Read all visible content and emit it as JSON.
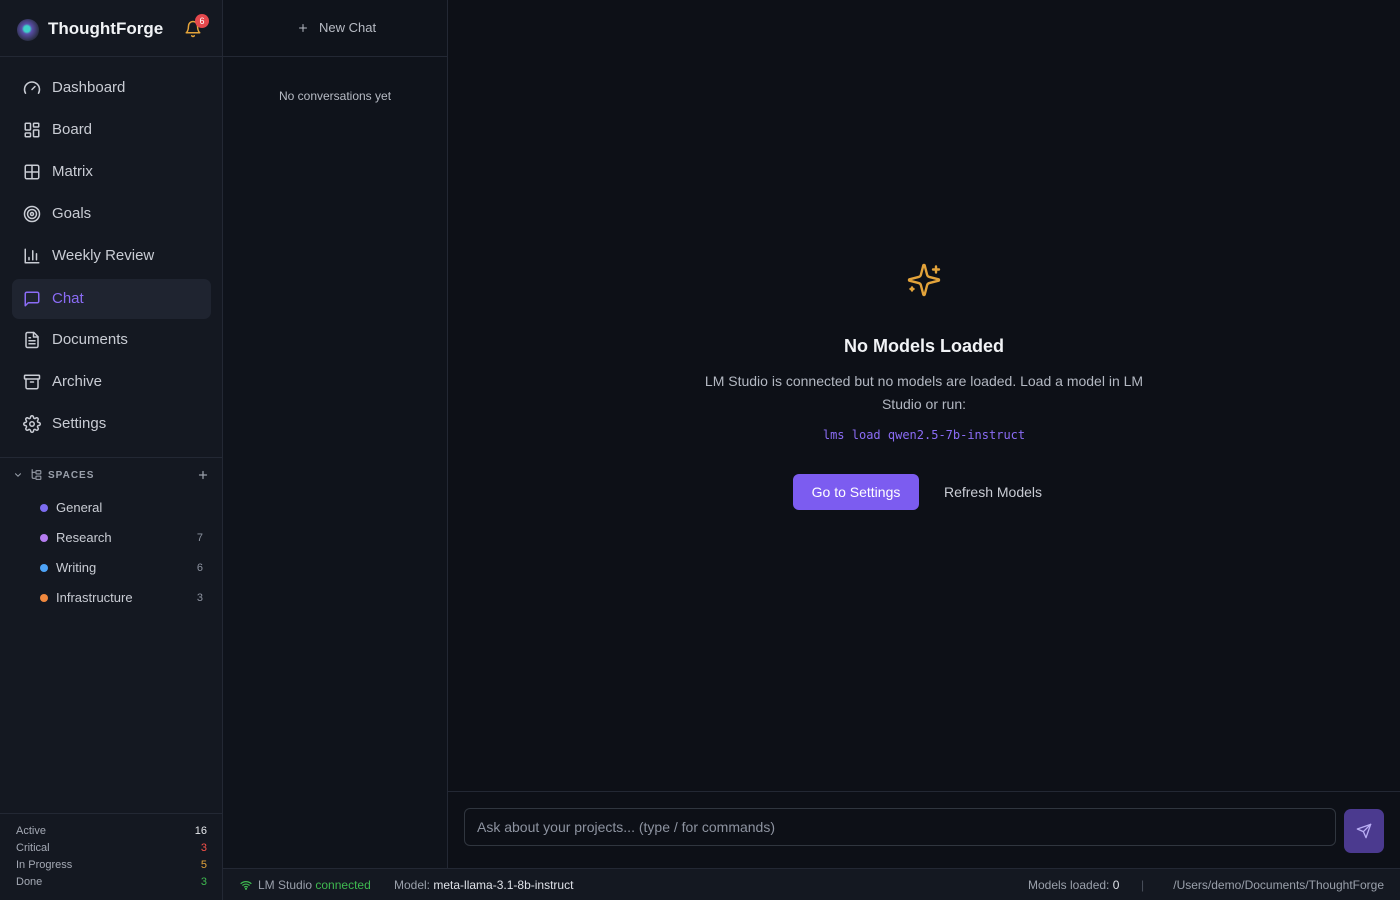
{
  "app": {
    "name": "ThoughtForge",
    "notification_count": "6"
  },
  "nav": {
    "items": [
      {
        "label": "Dashboard",
        "icon": "gauge-icon",
        "active": false
      },
      {
        "label": "Board",
        "icon": "board-icon",
        "active": false
      },
      {
        "label": "Matrix",
        "icon": "grid-icon",
        "active": false
      },
      {
        "label": "Goals",
        "icon": "target-icon",
        "active": false
      },
      {
        "label": "Weekly Review",
        "icon": "bar-chart-icon",
        "active": false
      },
      {
        "label": "Chat",
        "icon": "message-icon",
        "active": true
      },
      {
        "label": "Documents",
        "icon": "document-icon",
        "active": false
      },
      {
        "label": "Archive",
        "icon": "archive-icon",
        "active": false
      },
      {
        "label": "Settings",
        "icon": "gear-icon",
        "active": false
      }
    ]
  },
  "spaces": {
    "title": "SPACES",
    "items": [
      {
        "label": "General",
        "count": "",
        "color": "#7c6cf0"
      },
      {
        "label": "Research",
        "count": "7",
        "color": "#b57cf0"
      },
      {
        "label": "Writing",
        "count": "6",
        "color": "#4da3f7"
      },
      {
        "label": "Infrastructure",
        "count": "3",
        "color": "#f0883e"
      }
    ]
  },
  "stats": [
    {
      "label": "Active",
      "value": "16",
      "color": "#e6e8ec"
    },
    {
      "label": "Critical",
      "value": "3",
      "color": "#f85149"
    },
    {
      "label": "In Progress",
      "value": "5",
      "color": "#e3a33a"
    },
    {
      "label": "Done",
      "value": "3",
      "color": "#3fb950"
    }
  ],
  "conversations": {
    "new_chat_label": "New Chat",
    "empty_text": "No conversations yet"
  },
  "main": {
    "title": "No Models Loaded",
    "description": "LM Studio is connected but no models are loaded. Load a model in LM Studio or run:",
    "command": "lms load qwen2.5-7b-instruct",
    "primary_button": "Go to Settings",
    "secondary_button": "Refresh Models",
    "accent_color": "#7c5cf0"
  },
  "composer": {
    "placeholder": "Ask about your projects... (type / for commands)"
  },
  "statusbar": {
    "lm_label": "LM Studio",
    "lm_status": "connected",
    "model_label": "Model:",
    "model_value": "meta-llama-3.1-8b-instruct",
    "loaded_label": "Models loaded:",
    "loaded_value": "0",
    "divider": "|",
    "path": "/Users/demo/Documents/ThoughtForge"
  }
}
